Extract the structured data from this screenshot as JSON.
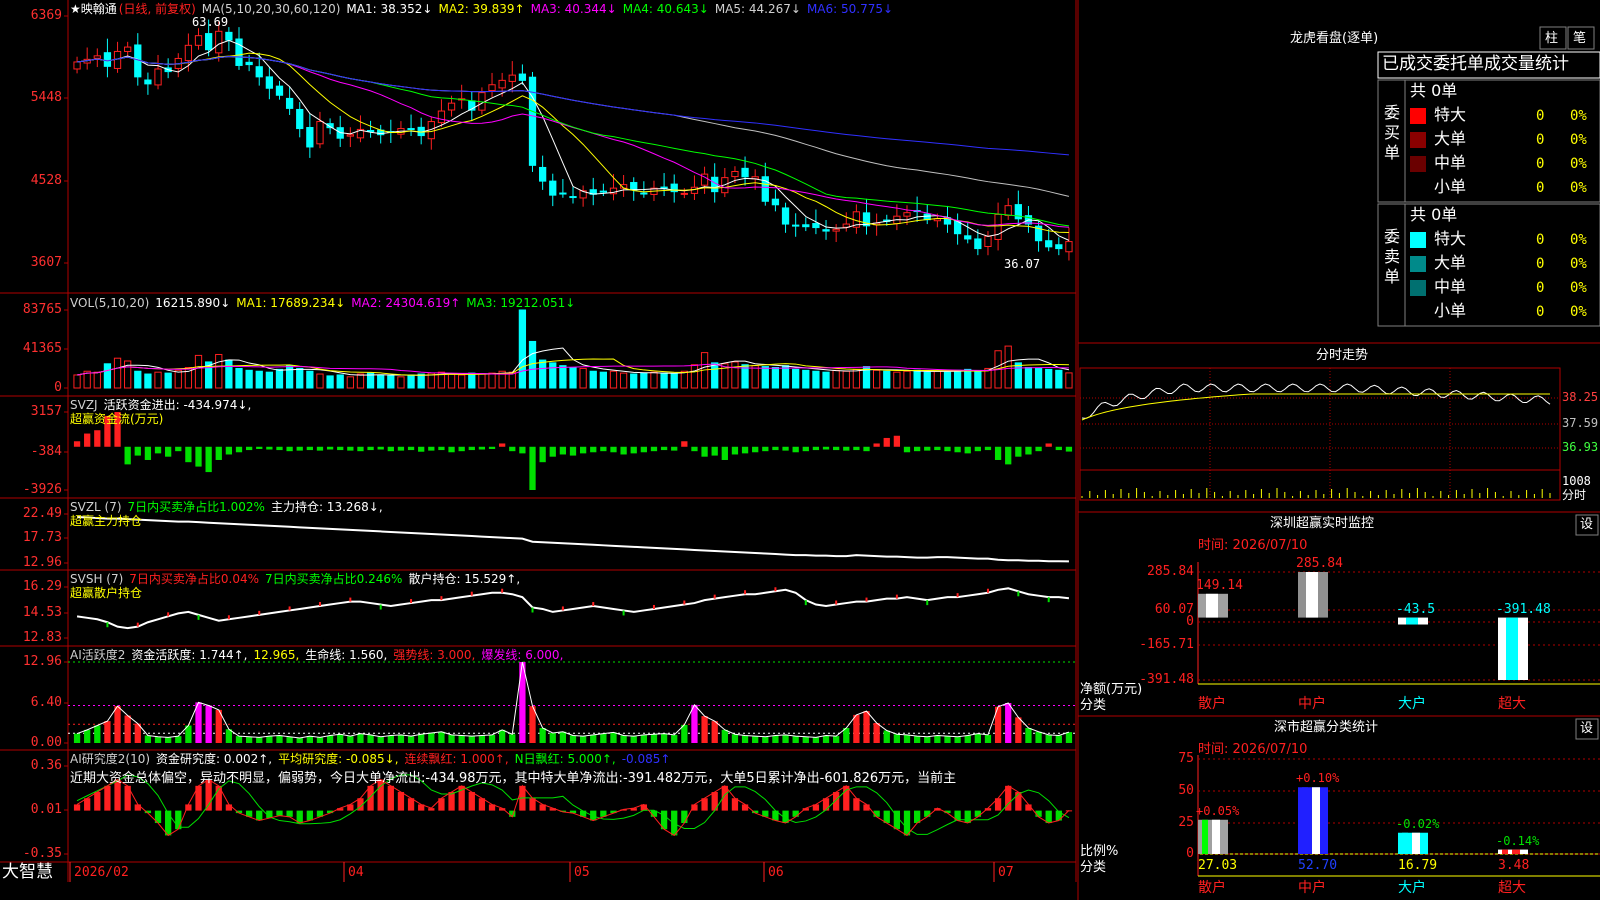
{
  "colors": {
    "up": "#ff2020",
    "down": "#00ffff",
    "green": "#00e000",
    "yellow": "#ffff00",
    "magenta": "#ff00ff",
    "white": "#ffffff",
    "blue": "#2020ff",
    "gray": "#c0c0c0",
    "border": "#b00000",
    "axis_text": "#ff3030"
  },
  "app": {
    "brand": "大智慧",
    "month_labels": [
      "2026/02",
      "04",
      "05",
      "06",
      "07"
    ]
  },
  "main_panel": {
    "title": "★映翰通",
    "mode": "(日线, 前复权)",
    "ma_legend": [
      {
        "text": "MA(5,10,20,30,60,120)",
        "color": "#d0d0d0"
      },
      {
        "text": "MA1: 38.352↓",
        "color": "#ffffff"
      },
      {
        "text": "MA2: 39.839↑",
        "color": "#ffff00"
      },
      {
        "text": "MA3: 40.344↓",
        "color": "#ff00ff"
      },
      {
        "text": "MA4: 40.643↓",
        "color": "#00ff00"
      },
      {
        "text": "MA5: 44.267↓",
        "color": "#d0d0d0"
      },
      {
        "text": "MA6: 50.775↓",
        "color": "#3030ff"
      }
    ],
    "y_ticks": [
      "6369",
      "5448",
      "4528",
      "3607"
    ],
    "max_label": "63.69",
    "min_label": "36.07"
  },
  "vol_panel": {
    "legend": [
      {
        "text": "VOL(5,10,20)",
        "color": "#d0d0d0"
      },
      {
        "text": "16215.890↓",
        "color": "#ffffff"
      },
      {
        "text": "MA1: 17689.234↓",
        "color": "#ffff00"
      },
      {
        "text": "MA2: 24304.619↑",
        "color": "#ff00ff"
      },
      {
        "text": "MA3: 19212.051↓",
        "color": "#00ff00"
      }
    ],
    "y_ticks": [
      "83765",
      "41365",
      "0"
    ]
  },
  "svzj_panel": {
    "legend": [
      {
        "text": "SVZJ",
        "color": "#d0d0d0"
      },
      {
        "text": "活跃资金进出: -434.974↓,",
        "color": "#ffffff"
      }
    ],
    "subtitle": "超赢资金流(万元)",
    "y_ticks": [
      "3157",
      "-384",
      "-3926"
    ]
  },
  "svzl_panel": {
    "legend": [
      {
        "text": "SVZL (7)",
        "color": "#d0d0d0"
      },
      {
        "text": "7日内买卖净占比1.002%",
        "color": "#00ff00"
      },
      {
        "text": "主力持仓: 13.268↓,",
        "color": "#ffffff"
      }
    ],
    "subtitle": "超赢主力持仓",
    "y_ticks": [
      "22.49",
      "17.73",
      "12.96"
    ]
  },
  "svsh_panel": {
    "legend": [
      {
        "text": "SVSH (7)",
        "color": "#d0d0d0"
      },
      {
        "text": "7日内买卖净占比0.04%",
        "color": "#ff2020"
      },
      {
        "text": "7日内买卖净占比0.246%",
        "color": "#00ff00"
      },
      {
        "text": "散户持仓: 15.529↑,",
        "color": "#ffffff"
      }
    ],
    "subtitle": "超赢散户持仓",
    "y_ticks": [
      "16.29",
      "14.53",
      "12.83"
    ]
  },
  "ai_active_panel": {
    "legend": [
      {
        "text": "AI活跃度2",
        "color": "#d0d0d0"
      },
      {
        "text": "资金活跃度: 1.744↑,",
        "color": "#ffffff"
      },
      {
        "text": "12.965,",
        "color": "#ffff00"
      },
      {
        "text": "生命线: 1.560,",
        "color": "#ffffff"
      },
      {
        "text": "强势线: 3.000,",
        "color": "#ff2020"
      },
      {
        "text": "爆发线: 6.000,",
        "color": "#ff00ff"
      }
    ],
    "y_ticks": [
      "12.96",
      "6.40",
      "0.00"
    ]
  },
  "ai_research_panel": {
    "legend": [
      {
        "text": "AI研究度2(10)",
        "color": "#d0d0d0"
      },
      {
        "text": "资金研究度: 0.002↑,",
        "color": "#ffffff"
      },
      {
        "text": "平均研究度: -0.085↓,",
        "color": "#ffff00"
      },
      {
        "text": "连续飘红: 1.000↑,",
        "color": "#ff2020"
      },
      {
        "text": "N日飘红: 5.000↑,",
        "color": "#00ff00"
      },
      {
        "text": "-0.085↑",
        "color": "#3030ff"
      }
    ],
    "note": "近期大资金总体偏空，异动不明显，偏弱势，今日大单净流出:-434.98万元，其中特大单净流出:-391.482万元，大单5日累计净出-601.826万元，当前主",
    "y_ticks": [
      "0.36",
      "0.01",
      "-0.35"
    ]
  },
  "right_panel": {
    "header_title": "龙虎看盘(逐单)",
    "header_buttons": [
      "柱",
      "笔"
    ],
    "stats_title": "已成交委托单成交量统计",
    "buy_group": {
      "label": "委买单",
      "count": "共 0单",
      "rows": [
        {
          "name": "特大",
          "value": "0",
          "pct": "0%",
          "color": "#ff0000"
        },
        {
          "name": "大单",
          "value": "0",
          "pct": "0%",
          "color": "#8a0000"
        },
        {
          "name": "中单",
          "value": "0",
          "pct": "0%",
          "color": "#6a0000"
        },
        {
          "name": "小单",
          "value": "0",
          "pct": "0%",
          "color": "#000000"
        }
      ]
    },
    "sell_group": {
      "label": "委卖单",
      "count": "共 0单",
      "rows": [
        {
          "name": "特大",
          "value": "0",
          "pct": "0%",
          "color": "#00ffff"
        },
        {
          "name": "大单",
          "value": "0",
          "pct": "0%",
          "color": "#008a8a"
        },
        {
          "name": "中单",
          "value": "0",
          "pct": "0%",
          "color": "#007070"
        },
        {
          "name": "小单",
          "value": "0",
          "pct": "0%",
          "color": "#000000"
        }
      ]
    },
    "intraday": {
      "title": "分时走势",
      "price_ticks": [
        "38.25",
        "37.59",
        "36.93"
      ],
      "vol_tick": "1008",
      "vol_unit": "分时"
    },
    "monitor": {
      "title": "深圳超赢实时监控",
      "setting": "设",
      "time": "时间: 2026/07/10",
      "y_ticks": [
        "285.84",
        "60.07",
        "0",
        "-165.71",
        "-391.48"
      ],
      "unit_label": "净额(万元)",
      "cat_label": "分类",
      "bars": [
        {
          "category": "散户",
          "value": 149.14,
          "label": "149.14"
        },
        {
          "category": "中户",
          "value": 285.84,
          "label": "285.84"
        },
        {
          "category": "大户",
          "value": -43.5,
          "label": "-43.5"
        },
        {
          "category": "超大",
          "value": -391.48,
          "label": "-391.48"
        }
      ]
    },
    "classify": {
      "title": "深市超赢分类统计",
      "setting": "设",
      "time": "时间: 2026/07/10",
      "y_ticks": [
        "75",
        "50",
        "25",
        "0"
      ],
      "unit_label": "比例%",
      "cat_label": "分类",
      "bars": [
        {
          "category": "散户",
          "value": 27.03,
          "label": "27.03",
          "change": "+0.05%"
        },
        {
          "category": "中户",
          "value": 52.7,
          "label": "52.70",
          "change": "+0.10%"
        },
        {
          "category": "大户",
          "value": 16.79,
          "label": "16.79",
          "change": "-0.02%"
        },
        {
          "category": "超大",
          "value": 3.48,
          "label": "3.48",
          "change": "-0.14%"
        }
      ]
    }
  },
  "chart_data": [
    {
      "type": "candlestick",
      "title": "映翰通",
      "ylim": [
        36.07,
        63.69
      ],
      "y_tick_labels": [
        "6369",
        "5448",
        "4528",
        "3607"
      ],
      "x_tick_labels": [
        "2026/02",
        "04",
        "05",
        "06",
        "07"
      ],
      "close": [
        58.9,
        59.2,
        59.6,
        58.4,
        60.1,
        60.6,
        57.2,
        56.4,
        58.1,
        57.8,
        59.3,
        60.8,
        61.9,
        60.3,
        62.4,
        61.4,
        58.5,
        58.6,
        57.2,
        55.9,
        55.1,
        53.6,
        51.3,
        49.2,
        52.1,
        51.4,
        50.2,
        50.6,
        51.2,
        51.0,
        50.6,
        50.9,
        51.3,
        51.2,
        50.5,
        52.1,
        53.3,
        54.2,
        54.7,
        53.4,
        55.4,
        56.3,
        56.8,
        57.4,
        56.8,
        47.1,
        45.3,
        43.7,
        43.9,
        43.5,
        44.2,
        43.8,
        44.1,
        44.5,
        44.9,
        44.3,
        43.9,
        44.5,
        44.6,
        44.1,
        43.9,
        44.6,
        46.1,
        44.1,
        45.7,
        46.4,
        45.8,
        45.8,
        43.0,
        42.6,
        40.4,
        40.2,
        40.1,
        40.0,
        39.6,
        39.8,
        40.4,
        41.8,
        40.2,
        40.5,
        40.7,
        41.3,
        41.7,
        41.9,
        40.9,
        41.0,
        40.4,
        39.3,
        38.7,
        37.6,
        39.0,
        41.5,
        42.5,
        41.0,
        40.4,
        38.5,
        37.8,
        37.6,
        38.4
      ],
      "ma_series": [
        {
          "name": "MA1",
          "color": "#ffffff"
        },
        {
          "name": "MA2",
          "color": "#ffff00"
        },
        {
          "name": "MA3",
          "color": "#ff00ff"
        },
        {
          "name": "MA4",
          "color": "#00ff00"
        },
        {
          "name": "MA5",
          "color": "#c0c0c0"
        },
        {
          "name": "MA6",
          "color": "#3030ff"
        }
      ]
    },
    {
      "type": "bar",
      "title": "VOL",
      "ylim": [
        0,
        83765
      ],
      "values": [
        14000,
        18000,
        17000,
        26000,
        32000,
        29000,
        18000,
        15000,
        17000,
        16000,
        19000,
        22000,
        35000,
        28000,
        36000,
        30000,
        21000,
        19000,
        18000,
        17000,
        20000,
        24000,
        21000,
        18000,
        15000,
        13000,
        14000,
        12000,
        15000,
        16000,
        14000,
        13000,
        12000,
        14000,
        15000,
        16000,
        17000,
        15000,
        14000,
        16000,
        15000,
        16000,
        18000,
        17000,
        83765,
        50000,
        30000,
        27000,
        24000,
        22000,
        21000,
        18000,
        17000,
        18000,
        16000,
        15000,
        16000,
        17000,
        16000,
        15000,
        18000,
        25000,
        38000,
        27000,
        26000,
        28000,
        25000,
        24000,
        23000,
        22000,
        24000,
        20000,
        19000,
        18000,
        17000,
        19000,
        18000,
        20000,
        23000,
        19000,
        18000,
        17000,
        18000,
        19000,
        17000,
        18000,
        17000,
        19000,
        20000,
        18000,
        21000,
        40000,
        45000,
        27000,
        22000,
        21000,
        20000,
        19000,
        16216
      ]
    },
    {
      "type": "bar",
      "title": "SVZJ 活跃资金进出",
      "ylim": [
        -3926,
        3157
      ],
      "values": [
        500,
        1200,
        1500,
        2800,
        3157,
        -1600,
        -800,
        -1200,
        -600,
        -900,
        -400,
        -1400,
        -1800,
        -2300,
        -1200,
        -700,
        -500,
        -300,
        -200,
        -250,
        -300,
        -400,
        -350,
        -300,
        -350,
        -250,
        -300,
        -350,
        -400,
        -300,
        -250,
        -400,
        -350,
        -300,
        -450,
        -350,
        -300,
        -500,
        -400,
        -300,
        -250,
        -200,
        300,
        -400,
        -600,
        -3926,
        -1400,
        -900,
        -700,
        -800,
        -600,
        -500,
        -400,
        -500,
        -700,
        -600,
        -500,
        -400,
        -300,
        -350,
        500,
        -400,
        -900,
        -800,
        -1200,
        -700,
        -600,
        -500,
        -400,
        -300,
        -350,
        -500,
        -400,
        -300,
        -250,
        -300,
        -350,
        -300,
        -400,
        300,
        800,
        1000,
        -500,
        -400,
        -350,
        -300,
        -400,
        -500,
        -600,
        -400,
        -300,
        -1200,
        -1600,
        -900,
        -700,
        -400,
        300,
        -300,
        -435
      ],
      "series_label": "超赢资金流(万元)"
    },
    {
      "type": "line",
      "title": "SVZL 主力持仓",
      "ylim": [
        12.96,
        22.49
      ],
      "values": [
        21.9,
        21.8,
        21.7,
        21.6,
        21.6,
        21.5,
        21.4,
        21.3,
        21.2,
        21.1,
        21.0,
        21.0,
        20.9,
        20.8,
        20.7,
        20.6,
        20.5,
        20.4,
        20.3,
        20.2,
        20.1,
        20.0,
        19.9,
        19.8,
        19.7,
        19.6,
        19.5,
        19.4,
        19.3,
        19.2,
        19.1,
        19.0,
        18.9,
        18.8,
        18.7,
        18.6,
        18.5,
        18.4,
        18.3,
        18.2,
        18.1,
        18.0,
        17.9,
        17.8,
        17.7,
        17.1,
        17.0,
        16.9,
        16.8,
        16.7,
        16.6,
        16.5,
        16.4,
        16.3,
        16.2,
        16.1,
        16.0,
        15.9,
        15.8,
        15.7,
        15.6,
        15.5,
        15.4,
        15.3,
        15.2,
        15.1,
        15.0,
        14.9,
        14.8,
        14.7,
        14.6,
        14.5,
        14.5,
        14.4,
        14.4,
        14.3,
        14.3,
        14.5,
        14.4,
        14.3,
        14.2,
        14.2,
        14.1,
        14.0,
        14.0,
        14.1,
        14.1,
        14.0,
        13.9,
        13.8,
        13.8,
        13.6,
        13.5,
        13.5,
        13.4,
        13.4,
        13.3,
        13.3,
        13.27
      ]
    },
    {
      "type": "line",
      "title": "SVSH 散户持仓",
      "ylim": [
        12.83,
        16.29
      ],
      "values": [
        14.3,
        14.2,
        14.1,
        13.9,
        13.6,
        13.5,
        13.6,
        13.9,
        14.1,
        14.3,
        14.5,
        14.6,
        14.4,
        14.2,
        14.0,
        14.1,
        14.2,
        14.3,
        14.4,
        14.5,
        14.6,
        14.7,
        14.8,
        14.9,
        15.0,
        15.1,
        15.2,
        15.3,
        15.3,
        15.2,
        15.1,
        15.0,
        15.1,
        15.2,
        15.3,
        15.4,
        15.4,
        15.5,
        15.6,
        15.7,
        15.8,
        15.9,
        15.9,
        15.8,
        15.6,
        14.9,
        14.8,
        14.6,
        14.7,
        14.8,
        14.9,
        15.0,
        14.9,
        14.8,
        14.7,
        14.6,
        14.7,
        14.8,
        14.9,
        15.0,
        15.1,
        15.2,
        15.4,
        15.5,
        15.6,
        15.7,
        15.8,
        15.8,
        15.9,
        16.0,
        16.1,
        15.9,
        15.4,
        15.1,
        15.0,
        15.1,
        15.2,
        15.3,
        15.3,
        15.4,
        15.5,
        15.5,
        15.6,
        15.5,
        15.4,
        15.5,
        15.6,
        15.6,
        15.7,
        15.8,
        15.9,
        16.1,
        16.2,
        16.0,
        15.8,
        15.7,
        15.6,
        15.6,
        15.53
      ]
    },
    {
      "type": "bar",
      "title": "AI活跃度2 资金活跃度",
      "ylim": [
        0,
        12.96
      ],
      "values": [
        1.5,
        2.1,
        2.8,
        3.5,
        5.9,
        4.4,
        3.1,
        1.2,
        1.0,
        0.9,
        1.1,
        2.8,
        6.5,
        6.0,
        5.3,
        2.2,
        1.1,
        1.0,
        0.9,
        1.1,
        1.2,
        1.0,
        0.8,
        1.1,
        0.9,
        1.2,
        1.4,
        1.1,
        1.5,
        1.3,
        1.0,
        1.2,
        1.3,
        1.1,
        1.4,
        1.6,
        1.8,
        1.3,
        1.2,
        1.1,
        1.2,
        1.3,
        2.1,
        1.4,
        12.96,
        5.9,
        2.4,
        1.6,
        1.8,
        1.2,
        1.1,
        1.3,
        1.5,
        1.7,
        1.2,
        1.1,
        1.3,
        1.4,
        1.5,
        1.3,
        2.9,
        6.1,
        4.3,
        3.5,
        2.1,
        1.4,
        1.2,
        1.1,
        1.0,
        1.2,
        1.3,
        1.1,
        1.0,
        0.9,
        1.2,
        1.1,
        2.4,
        4.5,
        5.1,
        3.2,
        2.0,
        1.4,
        1.3,
        1.1,
        1.0,
        1.2,
        1.1,
        1.0,
        1.2,
        1.5,
        1.3,
        5.8,
        6.4,
        4.1,
        2.4,
        1.8,
        1.3,
        1.2,
        1.744
      ]
    },
    {
      "type": "bar",
      "title": "AI研究度2(10) 资金研究度",
      "ylim": [
        -0.35,
        0.36
      ],
      "values": [
        0.05,
        0.1,
        0.15,
        0.2,
        0.25,
        0.2,
        0.05,
        -0.02,
        -0.1,
        -0.2,
        -0.15,
        0.05,
        0.2,
        0.25,
        0.2,
        0.05,
        -0.02,
        -0.05,
        -0.08,
        -0.06,
        -0.04,
        -0.05,
        -0.1,
        -0.08,
        -0.05,
        -0.02,
        0.02,
        0.05,
        0.1,
        0.2,
        0.25,
        0.2,
        0.15,
        0.1,
        0.05,
        0.02,
        0.1,
        0.15,
        0.2,
        0.15,
        0.1,
        0.05,
        0.02,
        -0.05,
        0.2,
        0.1,
        0.05,
        0.02,
        -0.01,
        -0.02,
        -0.05,
        -0.08,
        -0.05,
        -0.02,
        0.01,
        0.02,
        0.05,
        -0.05,
        -0.15,
        -0.2,
        -0.1,
        0.05,
        0.1,
        0.15,
        0.2,
        0.1,
        0.05,
        -0.02,
        -0.05,
        -0.08,
        -0.1,
        -0.05,
        0.02,
        0.05,
        0.1,
        0.15,
        0.2,
        0.1,
        0.05,
        -0.05,
        -0.1,
        -0.15,
        -0.2,
        -0.1,
        -0.05,
        0.02,
        -0.02,
        -0.08,
        -0.1,
        -0.05,
        0.02,
        0.1,
        0.2,
        0.15,
        0.05,
        -0.05,
        -0.1,
        -0.08,
        0.002
      ]
    },
    {
      "type": "bar",
      "title": "深圳超赢实时监控",
      "categories": [
        "散户",
        "中户",
        "大户",
        "超大"
      ],
      "values": [
        149.14,
        285.84,
        -43.5,
        -391.48
      ],
      "ylim": [
        -391.48,
        285.84
      ],
      "ylabel": "净额(万元)"
    },
    {
      "type": "bar",
      "title": "深市超赢分类统计",
      "categories": [
        "散户",
        "中户",
        "大户",
        "超大"
      ],
      "values": [
        27.03,
        52.7,
        16.79,
        3.48
      ],
      "changes": [
        "+0.05%",
        "+0.10%",
        "-0.02%",
        "-0.14%"
      ],
      "ylim": [
        0,
        75
      ],
      "ylabel": "比例%"
    }
  ]
}
